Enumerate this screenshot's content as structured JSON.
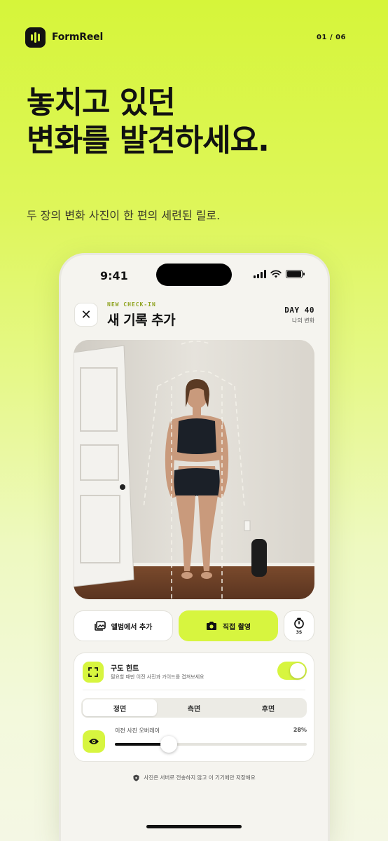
{
  "brand": {
    "name": "FormReel",
    "page_indicator": "01 / 06",
    "accent": "#d7f53f"
  },
  "hero": {
    "headline_line1": "놓치고 있던",
    "headline_line2": "변화를 발견하세요.",
    "subline": "두 장의 변화 사진이 한 편의 세련된 릴로."
  },
  "phone": {
    "status": {
      "time": "9:41",
      "icons": [
        "signal-icon",
        "wifi-icon",
        "battery-icon"
      ]
    },
    "header": {
      "eyebrow": "NEW CHECK-IN",
      "title": "새 기록 추가",
      "day_label": "DAY 40",
      "day_sub": "나의 변화",
      "close_icon": "close-icon"
    },
    "actions": {
      "album_label": "앨범에서 추가",
      "shoot_label": "직접 촬영",
      "timer_label": "3S"
    },
    "hint": {
      "title": "구도 힌트",
      "description": "필요할 때만 이전 사진과 가이드를 겹쳐보세요",
      "enabled": true
    },
    "view_tabs": [
      {
        "label": "정면",
        "active": true
      },
      {
        "label": "측면",
        "active": false
      },
      {
        "label": "후면",
        "active": false
      }
    ],
    "overlay": {
      "label": "이전 사진 오버레이",
      "value_text": "28%",
      "value": 0.28
    },
    "privacy_note": "사진은 서버로 전송하지 않고 이 기기에만 저장해요"
  }
}
